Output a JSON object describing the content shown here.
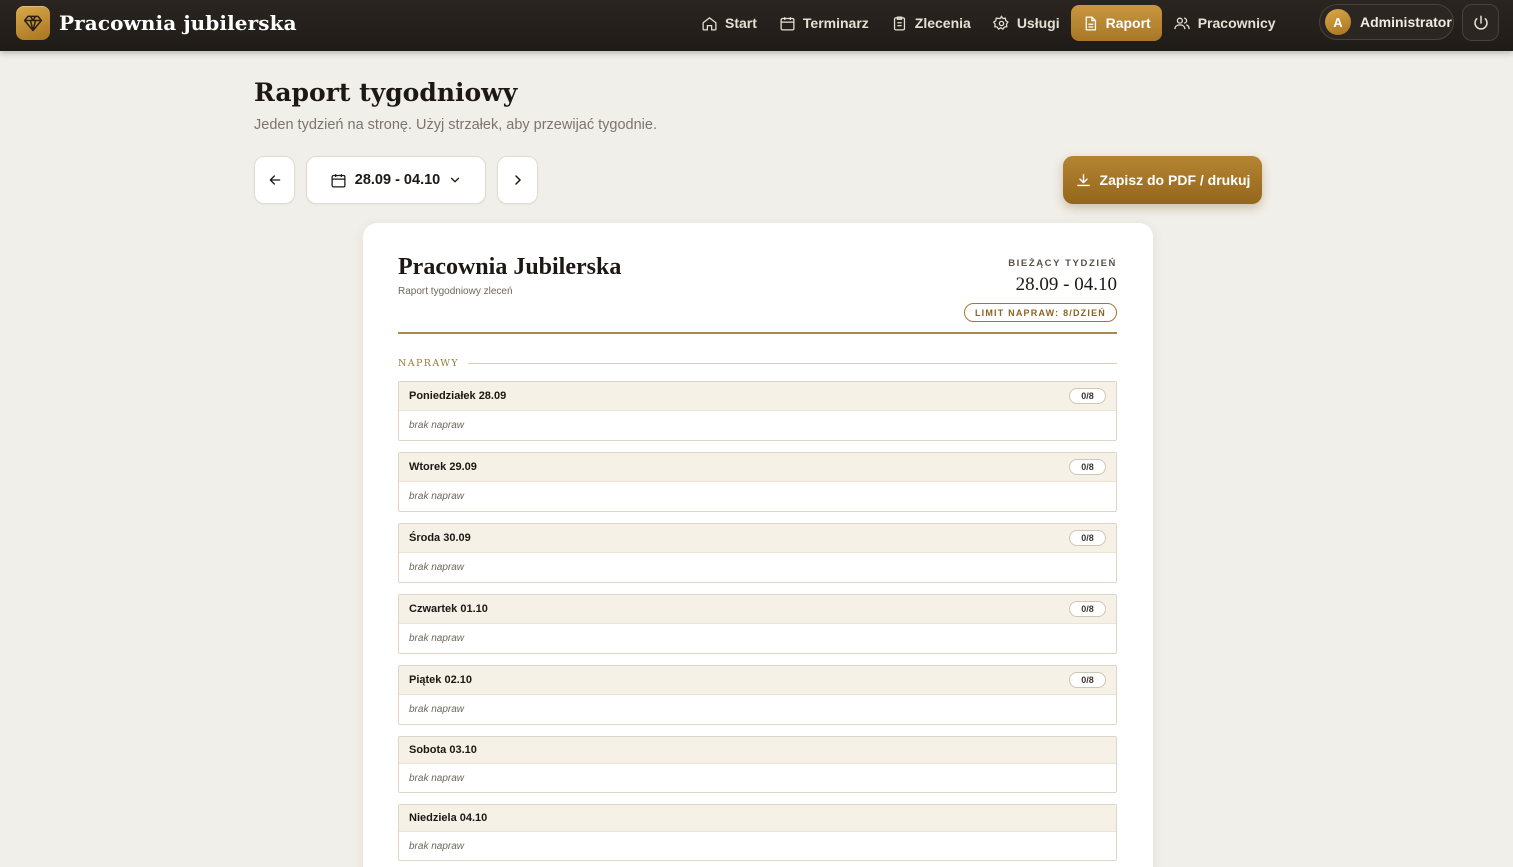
{
  "app": {
    "title": "Pracownia jubilerska",
    "logo_icon": "diamond-icon"
  },
  "nav": {
    "items": [
      {
        "label": "Start",
        "icon": "home-icon"
      },
      {
        "label": "Terminarz",
        "icon": "calendar-icon"
      },
      {
        "label": "Zlecenia",
        "icon": "clipboard-icon"
      },
      {
        "label": "Usługi",
        "icon": "gear-icon"
      },
      {
        "label": "Raport",
        "icon": "document-icon",
        "active": true
      },
      {
        "label": "Pracownicy",
        "icon": "users-icon"
      }
    ]
  },
  "user": {
    "initial": "A",
    "name": "Administrator"
  },
  "page": {
    "title": "Raport tygodniowy",
    "subtitle": "Jeden tydzień na stronę. Użyj strzałek, aby przewijać tygodnie.",
    "week_selector": "28.09 - 04.10",
    "pdf_button": "Zapisz do PDF / drukuj"
  },
  "report": {
    "title": "Pracownia Jubilerska",
    "subtitle": "Raport tygodniowy zleceń",
    "current_week_label": "BIEŻĄCY TYDZIEŃ",
    "current_week_range": "28.09 - 04.10",
    "limit_badge": "LIMIT NAPRAW: 8/DZIEŃ",
    "section_label": "NAPRAWY",
    "days": [
      {
        "name": "Poniedziałek 28.09",
        "count": "0/8",
        "empty_text": "brak napraw"
      },
      {
        "name": "Wtorek 29.09",
        "count": "0/8",
        "empty_text": "brak napraw"
      },
      {
        "name": "Środa 30.09",
        "count": "0/8",
        "empty_text": "brak napraw"
      },
      {
        "name": "Czwartek 01.10",
        "count": "0/8",
        "empty_text": "brak napraw"
      },
      {
        "name": "Piątek 02.10",
        "count": "0/8",
        "empty_text": "brak napraw"
      },
      {
        "name": "Sobota 03.10",
        "count": "",
        "empty_text": "brak napraw"
      },
      {
        "name": "Niedziela 04.10",
        "count": "",
        "empty_text": "brak napraw"
      }
    ]
  },
  "colors": {
    "accent": "#b48532",
    "topbar": "#1f1b17",
    "background": "#f1efe9"
  }
}
